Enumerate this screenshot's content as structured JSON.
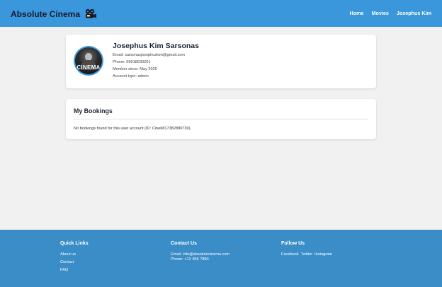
{
  "header": {
    "brand": "Absolute Cinema",
    "brand_icon": "film-camera-icon",
    "nav": {
      "home": "Home",
      "movies": "Movies",
      "user": "Josephus Kim"
    },
    "colors": {
      "bar": "#3a97db",
      "brand_text": "#1a1a2e"
    }
  },
  "profile": {
    "avatar_text": "CINEMA",
    "name": "Josephus Kim Sarsonas",
    "email": "Email: sarsonasjosephuskim@gmail.com",
    "phone": "Phone: 09918630201",
    "member_since": "Member since: May 2025",
    "account_type": "Account type: admin"
  },
  "bookings": {
    "title": "My Bookings",
    "empty_message": "No bookings found for this user account (ID: Cine6817382880730)."
  },
  "footer": {
    "quick_links": {
      "heading": "Quick Links",
      "about": "About us",
      "contact": "Contact",
      "faq": "FAQ"
    },
    "contact": {
      "heading": "Contact Us",
      "email": "Email: info@absolutecinema.com",
      "phone": "Phone: +12 456 7890"
    },
    "follow": {
      "heading": "Follow Us",
      "facebook": "Facebook",
      "twitter": "Twitter",
      "instagram": "Instagram"
    },
    "color": "#3a8dc7"
  }
}
